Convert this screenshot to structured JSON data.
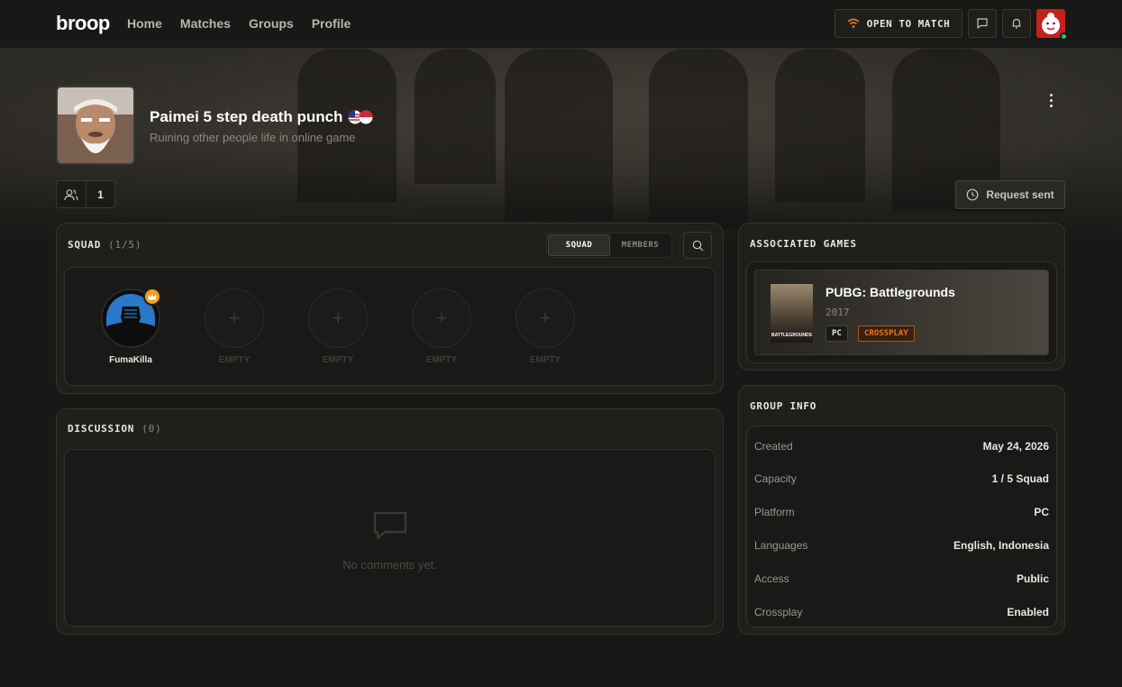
{
  "app": {
    "logo": "broop",
    "nav": [
      "Home",
      "Matches",
      "Groups",
      "Profile"
    ],
    "open_to_match": "OPEN TO MATCH",
    "icons": {
      "messages": "chat-icon",
      "notifications": "bell-icon"
    }
  },
  "group": {
    "name": "Paimei 5 step death punch",
    "tagline": "Ruining other people life in online game",
    "member_count": "1",
    "request_label": "Request sent",
    "flags": [
      "us-flag",
      "id-flag"
    ]
  },
  "squad": {
    "title": "SQUAD",
    "count": "(1/5)",
    "tabs": [
      "SQUAD",
      "MEMBERS"
    ],
    "active_tab": "SQUAD",
    "members": [
      {
        "name": "FumaKilla",
        "leader": true
      },
      {
        "name": "EMPTY"
      },
      {
        "name": "EMPTY"
      },
      {
        "name": "EMPTY"
      },
      {
        "name": "EMPTY"
      }
    ]
  },
  "discussion": {
    "title": "DISCUSSION",
    "count": "(0)",
    "empty_text": "No comments yet."
  },
  "associated_games": {
    "title": "ASSOCIATED GAMES",
    "game": {
      "name": "PUBG: Battlegrounds",
      "year": "2017",
      "cover_text": "BATTLEGROUNDS",
      "tags": [
        "PC",
        "CROSSPLAY"
      ]
    }
  },
  "group_info": {
    "title": "GROUP INFO",
    "rows": [
      {
        "label": "Created",
        "value": "May 24, 2026"
      },
      {
        "label": "Capacity",
        "value": "1 / 5 Squad"
      },
      {
        "label": "Platform",
        "value": "PC"
      },
      {
        "label": "Languages",
        "value": "English, Indonesia"
      },
      {
        "label": "Access",
        "value": "Public"
      },
      {
        "label": "Crossplay",
        "value": "Enabled"
      }
    ]
  },
  "colors": {
    "accent": "#e2781e",
    "online": "#35c45a",
    "crown": "#f0a020"
  }
}
